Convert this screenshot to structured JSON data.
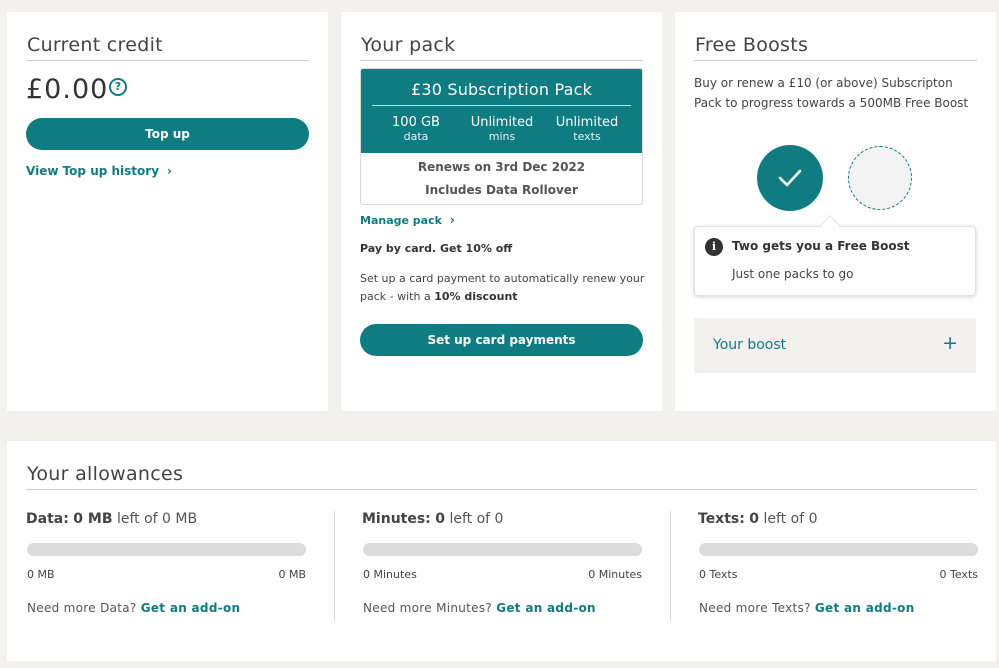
{
  "current_credit": {
    "title": "Current credit",
    "amount": "£0.00",
    "help_glyph": "?",
    "topup_label": "Top up",
    "history_link": "View Top up history",
    "chevron": "›"
  },
  "your_pack": {
    "title": "Your pack",
    "pack_name": "£30 Subscription Pack",
    "allowances": [
      {
        "amount": "100 GB",
        "unit": "data"
      },
      {
        "amount": "Unlimited",
        "unit": "mins"
      },
      {
        "amount": "Unlimited",
        "unit": "texts"
      }
    ],
    "renews": "Renews on 3rd Dec 2022",
    "rollover": "Includes Data Rollover",
    "manage_link": "Manage pack",
    "chevron": "›",
    "pay_heading": "Pay by card. Get 10% off",
    "pay_desc_prefix": "Set up a card payment to automatically renew your pack - with a ",
    "pay_desc_bold": "10% discount",
    "card_button": "Set up card payments"
  },
  "free_boosts": {
    "title": "Free Boosts",
    "description": "Buy or renew a £10 (or above) Subscripton Pack to progress towards a 500MB Free Boost",
    "progress": {
      "completed": 1,
      "total": 2
    },
    "tooltip_icon": "i",
    "tooltip_title": "Two gets you a Free Boost",
    "tooltip_sub": "Just one packs to go",
    "your_boost_label": "Your boost",
    "expand_glyph": "+"
  },
  "allowances": {
    "title": "Your allowances",
    "items": [
      {
        "label": "Data:",
        "value": "0 MB",
        "suffix": "left of 0 MB",
        "fill": 0,
        "min": "0 MB",
        "max": "0 MB",
        "more": "Need more Data?",
        "addon": "Get an add-on"
      },
      {
        "label": "Minutes:",
        "value": "0",
        "suffix": "left of 0",
        "fill": 0,
        "min": "0 Minutes",
        "max": "0 Minutes",
        "more": "Need more Minutes?",
        "addon": "Get an add-on"
      },
      {
        "label": "Texts:",
        "value": "0",
        "suffix": "left of 0",
        "fill": 0,
        "min": "0 Texts",
        "max": "0 Texts",
        "more": "Need more Texts?",
        "addon": "Get an add-on"
      }
    ]
  },
  "colors": {
    "accent": "#0f7c82",
    "background": "#f2f1ee",
    "card": "#ffffff"
  }
}
